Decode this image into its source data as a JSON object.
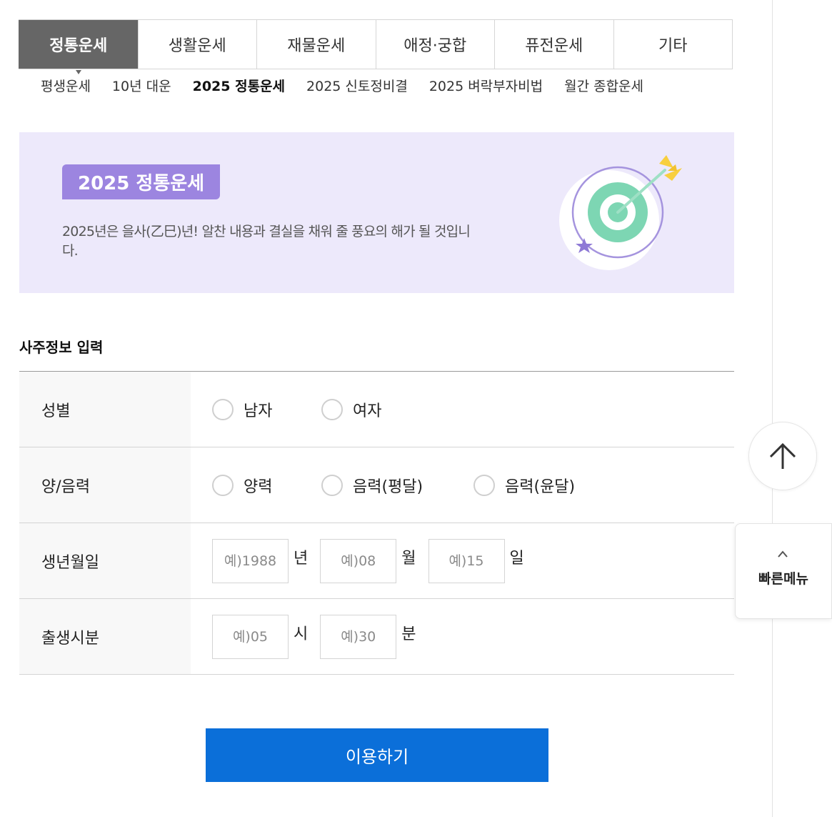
{
  "main_tabs": [
    {
      "label": "정통운세",
      "active": true
    },
    {
      "label": "생활운세",
      "active": false
    },
    {
      "label": "재물운세",
      "active": false
    },
    {
      "label": "애정·궁합",
      "active": false
    },
    {
      "label": "퓨전운세",
      "active": false
    },
    {
      "label": "기타",
      "active": false
    }
  ],
  "sub_tabs": [
    {
      "label": "평생운세",
      "active": false
    },
    {
      "label": "10년 대운",
      "active": false
    },
    {
      "label": "2025 정통운세",
      "active": true
    },
    {
      "label": "2025 신토정비결",
      "active": false
    },
    {
      "label": "2025 벼락부자비법",
      "active": false
    },
    {
      "label": "월간 종합운세",
      "active": false
    }
  ],
  "banner": {
    "badge": "2025 정통운세",
    "description": "2025년은 을사(乙巳)년! 알찬 내용과 결실을 채워 줄 풍요의 해가 될 것입니다.",
    "art_icon": "target-arrow-icon",
    "background_color": "#ede9fb",
    "badge_color": "#9c85e0"
  },
  "form": {
    "section_title": "사주정보 입력",
    "gender": {
      "label": "성별",
      "options": [
        "남자",
        "여자"
      ]
    },
    "calendar": {
      "label": "양/음력",
      "options": [
        "양력",
        "음력(평달)",
        "음력(윤달)"
      ]
    },
    "birth_date": {
      "label": "생년월일",
      "year_placeholder": "예)1988",
      "year_unit": "년",
      "month_placeholder": "예)08",
      "month_unit": "월",
      "day_placeholder": "예)15",
      "day_unit": "일"
    },
    "birth_time": {
      "label": "출생시분",
      "hour_placeholder": "예)05",
      "hour_unit": "시",
      "minute_placeholder": "예)30",
      "minute_unit": "분"
    }
  },
  "submit_label": "이용하기",
  "submit_color": "#0b6fd9",
  "scroll_top_icon": "arrow-up-icon",
  "quick_menu": {
    "icon": "chevron-up-icon",
    "label": "빠른메뉴"
  }
}
